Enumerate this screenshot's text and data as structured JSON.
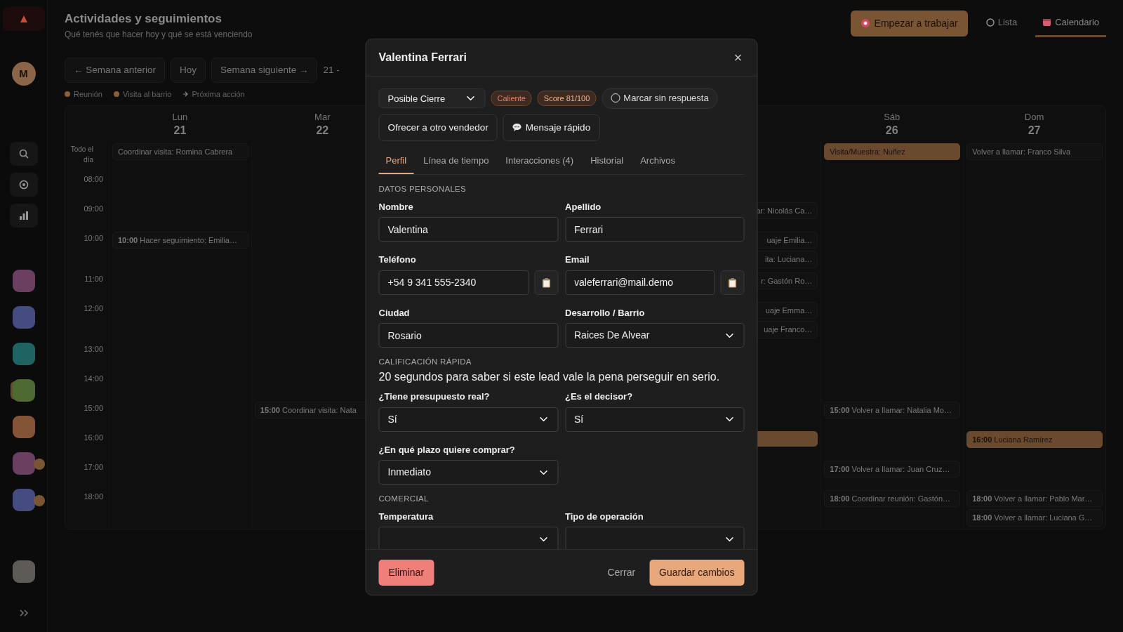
{
  "sidebar": {
    "avatar": "M",
    "contacts": [
      {
        "color": "#6a3f60",
        "selected": false,
        "badge": false
      },
      {
        "color": "#454c80",
        "selected": false,
        "badge": false
      },
      {
        "color": "#1f6462",
        "selected": false,
        "badge": false
      },
      {
        "color": "#4c6a32",
        "selected": true,
        "badge": false
      },
      {
        "color": "#845436",
        "selected": false,
        "badge": false
      },
      {
        "color": "#6a3f60",
        "selected": false,
        "badge": true
      },
      {
        "color": "#454c80",
        "selected": false,
        "badge": true
      },
      {
        "color": "#5e5a56",
        "selected": false,
        "badge": false
      }
    ]
  },
  "header": {
    "title": "Actividades y seguimientos",
    "subtitle": "Qué tenés que hacer hoy y qué se está venciendo",
    "start_button": "Empezar a trabajar",
    "views": [
      {
        "label": "Lista",
        "selected": false
      },
      {
        "label": "Calendario",
        "selected": true
      }
    ]
  },
  "toolbar": {
    "buttons": [
      "← Semana anterior",
      "Hoy",
      "Semana siguiente →"
    ],
    "range": "21 -"
  },
  "legend": [
    {
      "label": "Reunión",
      "kind": "dot",
      "color": "#8a5f38"
    },
    {
      "label": "Visita al barrio",
      "kind": "dot",
      "color": "#8a5f38"
    },
    {
      "label": "Próxima acción",
      "kind": "arrow"
    }
  ],
  "calendar": {
    "all_day_label": "Todo el día",
    "days": [
      {
        "name": "Lun",
        "date": "21",
        "all_day": [
          {
            "text": "Coordinar visita: Romina Cabrera",
            "highlighted": false
          }
        ]
      },
      {
        "name": "Mar",
        "date": "22"
      },
      {
        "name": "Sáb",
        "date": "26",
        "all_day": [
          {
            "text": "Visita/Muestra: Nuñez",
            "highlighted": true
          }
        ]
      },
      {
        "name": "Dom",
        "date": "27",
        "all_day": [
          {
            "text": "Volver a llamar: Franco Silva",
            "highlighted": false
          }
        ]
      }
    ],
    "rows": [
      {
        "time": "08:00",
        "cells": [
          {},
          {},
          {},
          {},
          {},
          {},
          {}
        ]
      },
      {
        "time": "09:00",
        "cells": [
          {},
          {},
          {},
          {},
          {
            "events": [
              {
                "text": "ar: Nicolás Ca…",
                "highlighted": false
              }
            ]
          },
          {},
          {}
        ]
      },
      {
        "time": "10:00",
        "cells": [
          {
            "events": [
              {
                "text": "**10:00** Hacer seguimiento: Emilia…",
                "highlighted": false
              }
            ]
          },
          {},
          {},
          {},
          {
            "events": [
              {
                "text": "uaje Emilia…",
                "highlighted": false
              },
              {
                "text": "ita: Luciana…",
                "highlighted": false
              }
            ]
          },
          {},
          {}
        ]
      },
      {
        "time": "11:00",
        "cells": [
          {},
          {},
          {},
          {},
          {
            "events": [
              {
                "text": "r: Gastón Ro…",
                "highlighted": false
              }
            ]
          },
          {},
          {}
        ]
      },
      {
        "time": "12:00",
        "cells": [
          {},
          {},
          {},
          {},
          {
            "events": [
              {
                "text": "uaje Emma…",
                "highlighted": false
              },
              {
                "text": "uaje Franco…",
                "highlighted": false
              }
            ]
          },
          {},
          {}
        ]
      },
      {
        "time": "13:00",
        "cells": [
          {},
          {},
          {},
          {},
          {},
          {},
          {}
        ]
      },
      {
        "time": "14:00",
        "cells": [
          {},
          {},
          {},
          {},
          {},
          {},
          {}
        ]
      },
      {
        "time": "15:00",
        "cells": [
          {},
          {
            "events": [
              {
                "text": "**15:00** Coordinar visita: Nata",
                "highlighted": false
              }
            ]
          },
          {},
          {},
          {},
          {
            "events": [
              {
                "text": "**15:00** Volver a llamar: Natalia Mo…",
                "highlighted": false
              }
            ]
          },
          {}
        ]
      },
      {
        "time": "16:00",
        "cells": [
          {},
          {},
          {},
          {},
          {
            "events": [
              {
                "highlighted": true
              }
            ]
          },
          {},
          {
            "events": [
              {
                "text": "**16:00** Luciana Ramírez",
                "highlighted": true
              }
            ]
          }
        ]
      },
      {
        "time": "17:00",
        "cells": [
          {},
          {},
          {},
          {},
          {},
          {
            "events": [
              {
                "text": "**17:00** Volver a llamar: Juan Cruz…",
                "highlighted": false
              }
            ]
          },
          {}
        ]
      },
      {
        "time": "18:00",
        "cells": [
          {},
          {},
          {},
          {},
          {},
          {
            "events": [
              {
                "text": "**18:00** Coordinar reunión: Gastón…",
                "highlighted": false
              }
            ]
          },
          {
            "events": [
              {
                "text": "**18:00** Volver a llamar: Pablo Mar…",
                "highlighted": false
              },
              {
                "text": "**18:00** Volver a llamar: Luciana G…",
                "highlighted": false
              }
            ]
          }
        ]
      }
    ]
  },
  "modal": {
    "title": "Valentina Ferrari",
    "stage": "Posible Cierre",
    "badges": [
      {
        "label": "Caliente",
        "kind": "temperature"
      },
      {
        "label": "Score 81/100",
        "kind": "score"
      }
    ],
    "no_reply": {
      "label": "Marcar sin respuesta",
      "checked": false
    },
    "actions": [
      {
        "label": "Ofrecer a otro vendedor",
        "kind": "plain"
      },
      {
        "label": "Mensaje rápido",
        "kind": "message"
      }
    ],
    "tabs": [
      {
        "label": "Perfil",
        "selected": true
      },
      {
        "label": "Línea de tiempo",
        "selected": false
      },
      {
        "label": "Interacciones (4)",
        "selected": false
      },
      {
        "label": "Historial",
        "selected": false
      },
      {
        "label": "Archivos",
        "selected": false
      }
    ],
    "sections": [
      {
        "heading": "DATOS PERSONALES",
        "fields": [
          {
            "label": "Nombre",
            "kind": "text",
            "value": "Valentina"
          },
          {
            "label": "Apellido",
            "kind": "text",
            "value": "Ferrari"
          },
          {
            "label": "Teléfono",
            "kind": "copy",
            "value": "+54 9 341 555-2340"
          },
          {
            "label": "Email",
            "kind": "copy",
            "value": "valeferrari@mail.demo"
          },
          {
            "label": "Ciudad",
            "kind": "text",
            "value": "Rosario"
          },
          {
            "label": "Desarrollo / Barrio",
            "kind": "select",
            "value": "Raices De Alvear"
          }
        ]
      },
      {
        "heading": "CALIFICACIÓN RÁPIDA",
        "description": "20 segundos para saber si este lead vale la pena perseguir en serio.",
        "fields": [
          {
            "label": "¿Tiene presupuesto real?",
            "kind": "select",
            "value": "Sí"
          },
          {
            "label": "¿Es el decisor?",
            "kind": "select",
            "value": "Sí"
          },
          {
            "label": "¿En qué plazo quiere comprar?",
            "kind": "select",
            "value": "Inmediato"
          }
        ]
      },
      {
        "heading": "COMERCIAL",
        "fields": [
          {
            "label": "Temperatura",
            "kind": "select"
          },
          {
            "label": "Tipo de operación",
            "kind": "select"
          }
        ]
      }
    ],
    "footer": {
      "delete": "Eliminar",
      "close": "Cerrar",
      "save": "Guardar cambios"
    }
  }
}
